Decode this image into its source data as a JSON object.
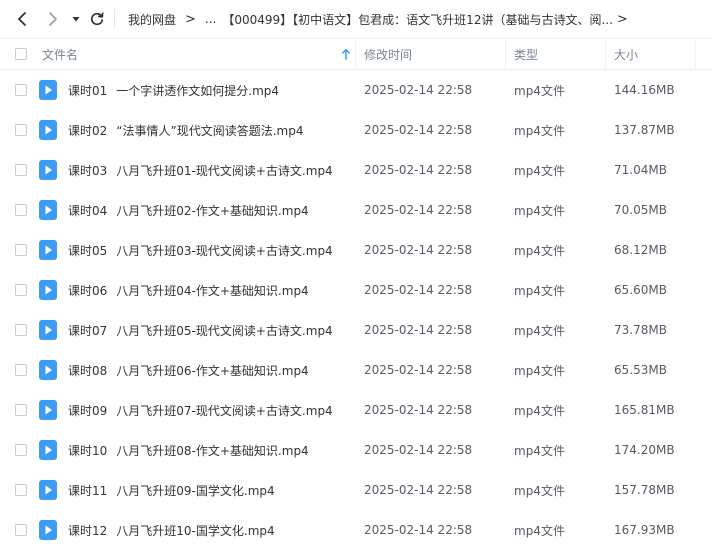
{
  "breadcrumb": {
    "root": "我的网盘",
    "ellipsis": "...",
    "current": "【000499】【初中语文】包君成：语文飞升班12讲（基础与古诗文、阅..."
  },
  "columns": {
    "name": "文件名",
    "modified": "修改时间",
    "type": "类型",
    "size": "大小"
  },
  "files": [
    {
      "index": "课时01",
      "title": "一个字讲透作文如何提分.mp4",
      "modified": "2025-02-14 22:58",
      "type": "mp4文件",
      "size": "144.16MB"
    },
    {
      "index": "课时02",
      "title": "“法事情人”现代文阅读答题法.mp4",
      "modified": "2025-02-14 22:58",
      "type": "mp4文件",
      "size": "137.87MB"
    },
    {
      "index": "课时03",
      "title": "八月飞升班01-现代文阅读+古诗文.mp4",
      "modified": "2025-02-14 22:58",
      "type": "mp4文件",
      "size": "71.04MB"
    },
    {
      "index": "课时04",
      "title": "八月飞升班02-作文+基础知识.mp4",
      "modified": "2025-02-14 22:58",
      "type": "mp4文件",
      "size": "70.05MB"
    },
    {
      "index": "课时05",
      "title": "八月飞升班03-现代文阅读+古诗文.mp4",
      "modified": "2025-02-14 22:58",
      "type": "mp4文件",
      "size": "68.12MB"
    },
    {
      "index": "课时06",
      "title": "八月飞升班04-作文+基础知识.mp4",
      "modified": "2025-02-14 22:58",
      "type": "mp4文件",
      "size": "65.60MB"
    },
    {
      "index": "课时07",
      "title": "八月飞升班05-现代文阅读+古诗文.mp4",
      "modified": "2025-02-14 22:58",
      "type": "mp4文件",
      "size": "73.78MB"
    },
    {
      "index": "课时08",
      "title": "八月飞升班06-作文+基础知识.mp4",
      "modified": "2025-02-14 22:58",
      "type": "mp4文件",
      "size": "65.53MB"
    },
    {
      "index": "课时09",
      "title": "八月飞升班07-现代文阅读+古诗文.mp4",
      "modified": "2025-02-14 22:58",
      "type": "mp4文件",
      "size": "165.81MB"
    },
    {
      "index": "课时10",
      "title": "八月飞升班08-作文+基础知识.mp4",
      "modified": "2025-02-14 22:58",
      "type": "mp4文件",
      "size": "174.20MB"
    },
    {
      "index": "课时11",
      "title": "八月飞升班09-国学文化.mp4",
      "modified": "2025-02-14 22:58",
      "type": "mp4文件",
      "size": "157.78MB"
    },
    {
      "index": "课时12",
      "title": "八月飞升班10-国学文化.mp4",
      "modified": "2025-02-14 22:58",
      "type": "mp4文件",
      "size": "167.93MB"
    }
  ],
  "colors": {
    "video_icon": "#3b9cf2",
    "sort_arrow": "#3b9cf2"
  },
  "icons": {
    "back": "chevron-left-icon",
    "forward": "chevron-right-icon",
    "dropdown": "caret-down-icon",
    "refresh": "refresh-icon",
    "file": "video-file-icon",
    "sort": "arrow-up-icon"
  }
}
